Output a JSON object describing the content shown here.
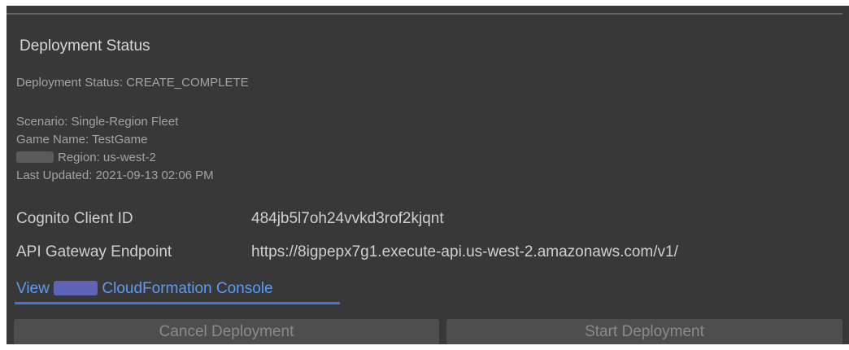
{
  "panel": {
    "title": "Deployment Status",
    "status_line": "Deployment Status: CREATE_COMPLETE",
    "meta": {
      "scenario": "Scenario: Single-Region Fleet",
      "game_name": "Game Name: TestGame",
      "region": "Region: us-west-2",
      "last_updated": "Last Updated: 2021-09-13 02:06 PM"
    },
    "details": [
      {
        "label": "Cognito Client ID",
        "value": "484jb5l7oh24vvkd3rof2kjqnt"
      },
      {
        "label": "API Gateway Endpoint",
        "value": "https://8igpepx7g1.execute-api.us-west-2.amazonaws.com/v1/"
      }
    ],
    "link": {
      "prefix": "View",
      "suffix": "CloudFormation Console"
    },
    "buttons": {
      "cancel": "Cancel Deployment",
      "start": "Start Deployment"
    }
  },
  "colors": {
    "background": "#383838",
    "text": "#d0d0d0",
    "muted": "#a3a3a3",
    "link": "#5d9bf2",
    "button": "#4e4e4e"
  }
}
